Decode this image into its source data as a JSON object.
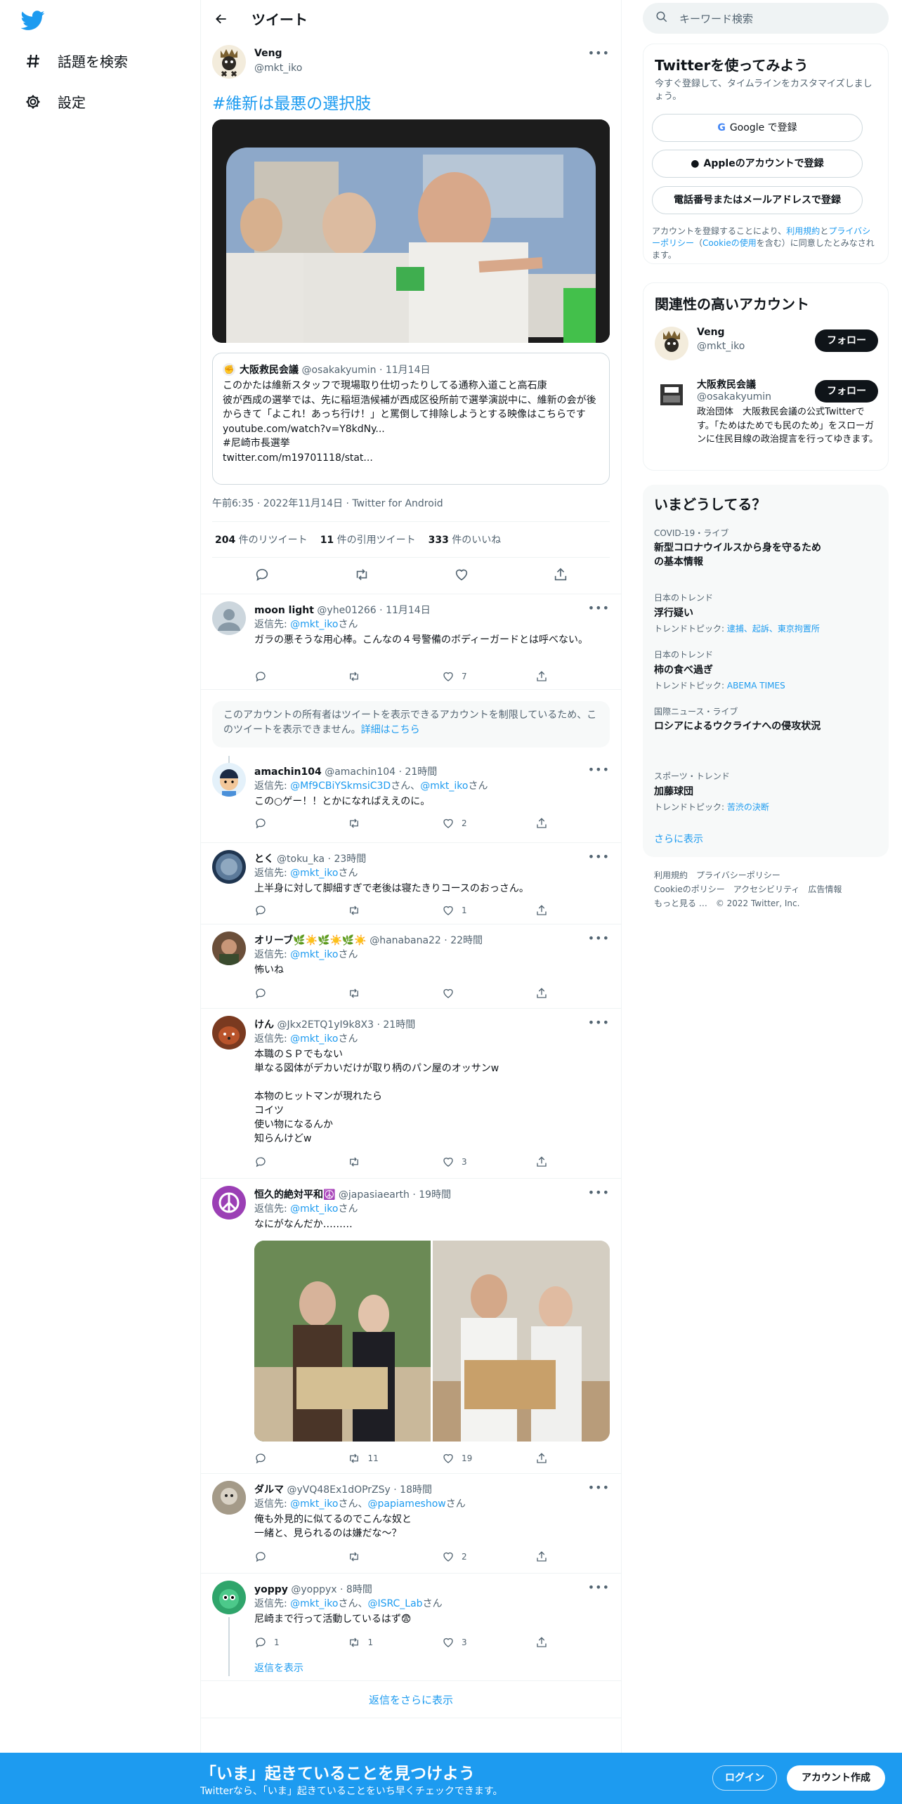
{
  "nav": {
    "explore": "話題を検索",
    "settings": "設定"
  },
  "header": {
    "title": "ツイート"
  },
  "tweet": {
    "name": "Veng",
    "handle": "@mkt_iko",
    "hashtag": "#維新は最悪の選択肢",
    "quote": {
      "name": "大阪救民会議",
      "handle": "@osakakyumin",
      "date": "· 11月14日",
      "text": "このかたは維新スタッフで現場取り仕切ったりしてる通称入道こと高石康\n彼が西成の選挙では、先に稲垣浩候補が西成区役所前で選挙演説中に、維新の会が後からきて「よこれ！あっち行け！」と罵倒して排除しようとする映像はこちらです\nyoutube.com/watch?v=Y8kdNy...\n#尼崎市長選挙\ntwitter.com/m19701118/stat..."
    },
    "meta": "午前6:35 · 2022年11月14日 · Twitter for Android",
    "retweets": "204",
    "retweets_label": "件のリツイート",
    "quotes": "11",
    "quotes_label": "件の引用ツイート",
    "likes": "333",
    "likes_label": "件のいいね"
  },
  "restricted": {
    "text": "このアカウントの所有者はツイートを表示できるアカウントを制限しているため、このツイートを表示できません。",
    "link": "詳細はこちら"
  },
  "replies": [
    {
      "name": "moon light",
      "handle": "@yhe01266",
      "time": "· 11月14日",
      "to_prefix": "返信先: ",
      "to": "@mkt_iko",
      "to_suffix": "さん",
      "text": "ガラの悪そうな用心棒。こんなの４号警備のボディーガードとは呼べない。",
      "reply_count": "",
      "rt_count": "",
      "like_count": "7"
    },
    {
      "name": "amachin104",
      "handle": "@amachin104",
      "time": "· 21時間",
      "to_prefix": "返信先: ",
      "to": "@Mf9CBiYSkmsiC3D",
      "to_suffix": "さん、",
      "to2": "@mkt_iko",
      "to2_suffix": "さん",
      "text": "この○ゲー！！とかになればええのに。",
      "reply_count": "",
      "rt_count": "",
      "like_count": "2"
    },
    {
      "name": "とく",
      "handle": "@toku_ka",
      "time": "· 23時間",
      "to_prefix": "返信先: ",
      "to": "@mkt_iko",
      "to_suffix": "さん",
      "text": "上半身に対して脚細すぎで老後は寝たきりコースのおっさん。",
      "reply_count": "",
      "rt_count": "",
      "like_count": "1"
    },
    {
      "name": "オリーブ🌿☀️🌿☀️🌿☀️",
      "handle": "@hanabana22",
      "time": "· 22時間",
      "to_prefix": "返信先: ",
      "to": "@mkt_iko",
      "to_suffix": "さん",
      "text": "怖いね",
      "reply_count": "",
      "rt_count": "",
      "like_count": ""
    },
    {
      "name": "けん",
      "handle": "@Jkx2ETQ1yI9k8X3",
      "time": "· 21時間",
      "to_prefix": "返信先: ",
      "to": "@mkt_iko",
      "to_suffix": "さん",
      "text": "本職のＳＰでもない\n単なる図体がデカいだけが取り柄のパン屋のオッサンw\n\n本物のヒットマンが現れたら\nコイツ\n使い物になるんか\n知らんけどw",
      "reply_count": "",
      "rt_count": "",
      "like_count": "3"
    },
    {
      "name": "恒久的絶対平和☮️",
      "handle": "@japasiaearth",
      "time": "· 19時間",
      "to_prefix": "返信先: ",
      "to": "@mkt_iko",
      "to_suffix": "さん",
      "text": "なにがなんだか………",
      "reply_count": "",
      "rt_count": "11",
      "like_count": "19"
    },
    {
      "name": "ダルマ",
      "handle": "@yVQ48Ex1dOPrZSy",
      "time": "· 18時間",
      "to_prefix": "返信先: ",
      "to": "@mkt_iko",
      "to_suffix": "さん、",
      "to2": "@papiameshow",
      "to2_suffix": "さん",
      "text": "俺も外見的に似てるのでこんな奴と\n一緒と、見られるのは嫌だな～？",
      "reply_count": "",
      "rt_count": "",
      "like_count": "2"
    },
    {
      "name": "yoppy",
      "handle": "@yoppyx",
      "time": "· 8時間",
      "to_prefix": "返信先: ",
      "to": "@mkt_iko",
      "to_suffix": "さん、",
      "to2": "@ISRC_Lab",
      "to2_suffix": "さん",
      "text": "尼崎まで行って活動しているはず😨",
      "reply_count": "1",
      "rt_count": "1",
      "like_count": "3"
    }
  ],
  "show_replies": "返信を表示",
  "more_replies": "返信をさらに表示",
  "search": {
    "placeholder": "キーワード検索"
  },
  "signup": {
    "title": "Twitterを使ってみよう",
    "subtitle": "今すぐ登録して、タイムラインをカスタマイズしましょう。",
    "google": "Google で登録",
    "apple": "Appleのアカウントで登録",
    "phone": "電話番号またはメールアドレスで登録",
    "legal_1": "アカウントを登録することにより、",
    "legal_terms": "利用規約",
    "legal_2": "と",
    "legal_privacy": "プライバシーポリシー",
    "legal_3": "（",
    "legal_cookie": "Cookieの使用",
    "legal_4": "を含む）に同意したとみなされます。"
  },
  "relevant": {
    "title": "関連性の高いアカウント",
    "follow": "フォロー",
    "accounts": [
      {
        "name": "Veng",
        "handle": "@mkt_iko",
        "bio": ""
      },
      {
        "name": "大阪救民会議",
        "handle": "@osakakyumin",
        "bio": "政治団体　大阪救民会議の公式Twitterです。「ためはためでも民のため」をスローガンに住民目線の政治提言を行ってゆきます。"
      }
    ]
  },
  "trends": {
    "title": "いまどうしてる？",
    "items": [
      {
        "context": "COVID-19・ライブ",
        "name": "新型コロナウイルスから身を守るための基本情報",
        "topic_label": "",
        "topic": ""
      },
      {
        "context": "日本のトレンド",
        "name": "浮行疑い",
        "topic_label": "トレンドトピック: ",
        "topic": "逮捕、起訴、東京拘置所"
      },
      {
        "context": "日本のトレンド",
        "name": "柿の食べ過ぎ",
        "topic_label": "トレンドトピック: ",
        "topic": "ABEMA TIMES"
      },
      {
        "context": "国際ニュース・ライブ",
        "name": "ロシアによるウクライナへの侵攻状況",
        "topic_label": "",
        "topic": ""
      },
      {
        "context": "スポーツ・トレンド",
        "name": "加藤球団",
        "topic_label": "トレンドトピック: ",
        "topic": "苦渋の決断"
      }
    ],
    "more": "さらに表示"
  },
  "footer": {
    "terms": "利用規約",
    "privacy": "プライバシーポリシー",
    "cookie": "Cookieのポリシー",
    "accessibility": "アクセシビリティ",
    "ads": "広告情報",
    "more": "もっと見る …",
    "copyright": "© 2022 Twitter, Inc."
  },
  "bottom": {
    "headline": "「いま」起きていることを見つけよう",
    "sub": "Twitterなら、「いま」起きていることをいち早くチェックできます。",
    "login": "ログイン",
    "signup": "アカウント作成"
  },
  "colors": {
    "accent": "#1d9bf0",
    "text": "#0f1419",
    "muted": "#536471"
  }
}
